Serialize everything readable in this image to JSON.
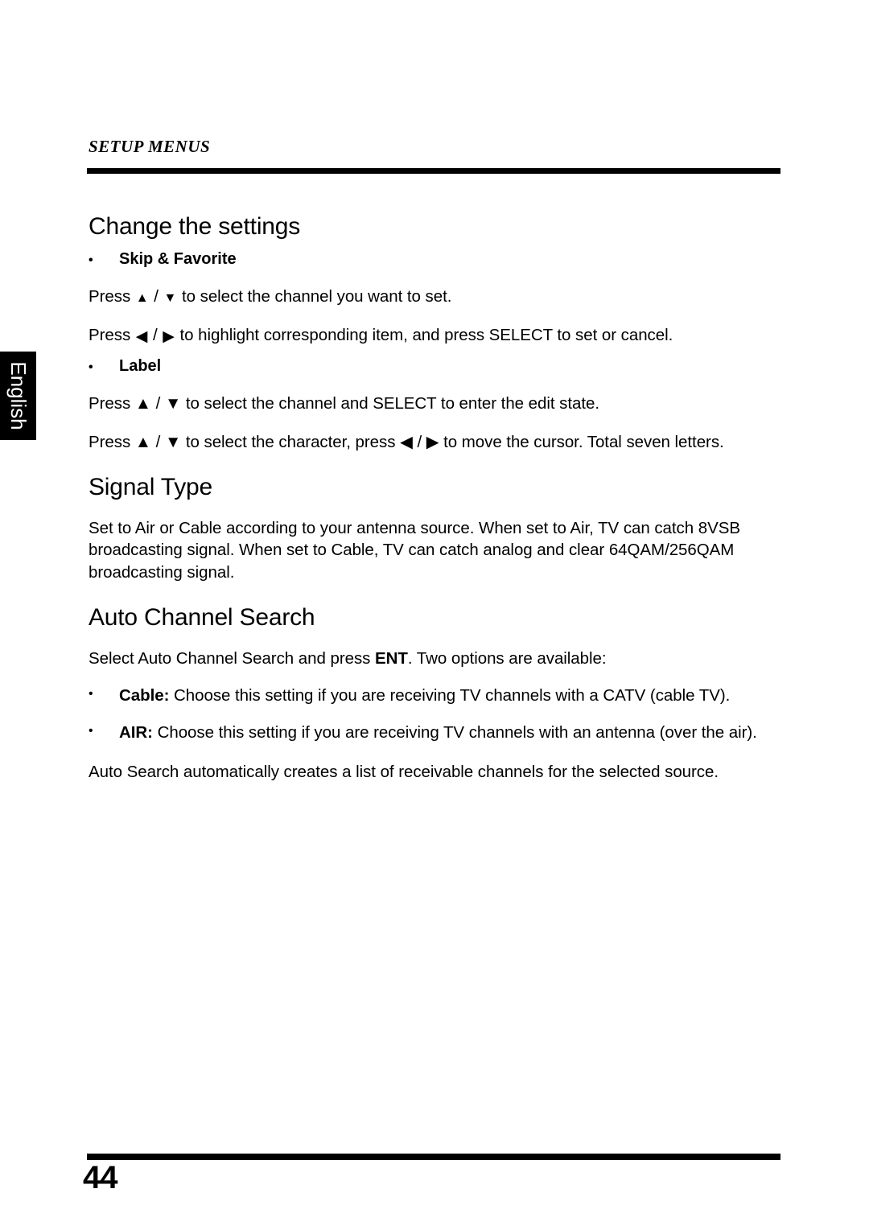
{
  "document": {
    "running_head": "SETUP MENUS",
    "language_tab": "English",
    "page_number": "44"
  },
  "sections": [
    {
      "id": "change-the-settings",
      "title": "Change the settings",
      "subsections": [
        {
          "id": "skip-and-favorite",
          "bullet": "•",
          "heading": "Skip & Favorite",
          "paragraphs": [
            {
              "id": "skip-favorite-p1",
              "parts": [
                {
                  "type": "text",
                  "value": "Press "
                },
                {
                  "type": "icon",
                  "name": "arrow-up-icon",
                  "glyph": "▲"
                },
                {
                  "type": "text",
                  "value": " / "
                },
                {
                  "type": "icon",
                  "name": "arrow-down-icon",
                  "glyph": "▼"
                },
                {
                  "type": "text",
                  "value": " to select the channel you want to set."
                }
              ],
              "plain": "Press ▲ / ▼ to select the channel you want to set."
            },
            {
              "id": "skip-favorite-p2",
              "parts": [
                {
                  "type": "text",
                  "value": "Press "
                },
                {
                  "type": "icon",
                  "name": "arrow-left-icon",
                  "glyph": "◀"
                },
                {
                  "type": "text",
                  "value": " / "
                },
                {
                  "type": "icon",
                  "name": "arrow-right-icon",
                  "glyph": "▶"
                },
                {
                  "type": "text",
                  "value": " to highlight corresponding item, and press SELECT to set or cancel."
                }
              ],
              "plain": "Press ◀ / ▶ to highlight corresponding item, and press SELECT to set or cancel."
            }
          ]
        },
        {
          "id": "label",
          "bullet": "•",
          "heading": "Label",
          "paragraphs": [
            {
              "id": "label-p1",
              "plain": "Press ▲ / ▼ to select the channel and SELECT to enter the edit state."
            },
            {
              "id": "label-p2",
              "plain": "Press ▲ / ▼ to select the character, press ◀ / ▶ to move the cursor. Total seven letters."
            }
          ]
        }
      ]
    },
    {
      "id": "signal-type",
      "title": "Signal Type",
      "paragraphs": [
        {
          "id": "signal-type-p1",
          "text": "Set to Air or Cable according to your antenna source. When set to Air, TV can catch 8VSB broadcasting signal. When set to Cable, TV can catch analog and clear 64QAM/256QAM broadcasting signal."
        }
      ]
    },
    {
      "id": "auto-channel-search",
      "title": "Auto Channel Search",
      "intro_prefix": "Select Auto Channel Search and press ",
      "intro_bold": "ENT",
      "intro_suffix": ". Two options are available:",
      "options": [
        {
          "id": "option-cable",
          "bullet": "•",
          "label": "Cable:",
          "text": " Choose this setting if you are receiving TV channels with a CATV (cable TV)."
        },
        {
          "id": "option-air",
          "bullet": "•",
          "label": "AIR:",
          "text": " Choose this setting if you are receiving TV channels with an antenna (over the air)."
        }
      ],
      "closing": "Auto Search automatically creates a list of receivable channels for the selected source."
    }
  ],
  "colors": {
    "ink": "#000000",
    "paper": "#ffffff",
    "tab_background": "#000000",
    "tab_text": "#ffffff"
  }
}
